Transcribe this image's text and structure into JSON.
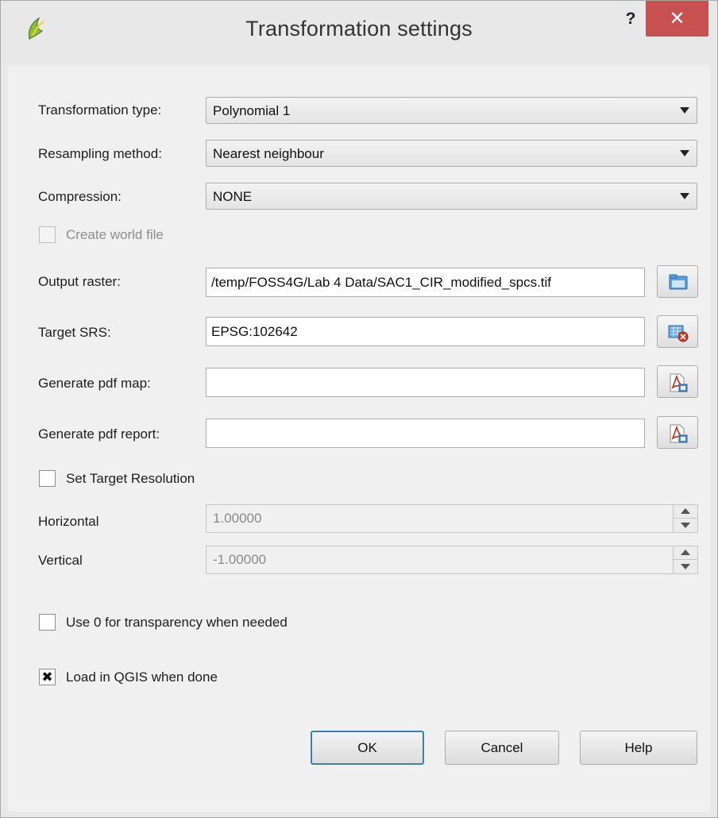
{
  "window": {
    "title": "Transformation settings",
    "help_glyph": "?",
    "close_glyph": "✕",
    "app_icon": "qgis-logo-icon"
  },
  "form": {
    "transformation_type": {
      "label": "Transformation type:",
      "value": "Polynomial 1"
    },
    "resampling_method": {
      "label": "Resampling method:",
      "value": "Nearest neighbour"
    },
    "compression": {
      "label": "Compression:",
      "value": "NONE"
    },
    "create_world_file": {
      "label": "Create world file",
      "checked": false,
      "enabled": false
    },
    "output_raster": {
      "label": "Output raster:",
      "value": "/temp/FOSS4G/Lab 4 Data/SAC1_CIR_modified_spcs.tif",
      "button_icon": "folder-open-icon"
    },
    "target_srs": {
      "label": "Target SRS:",
      "value": "EPSG:102642",
      "button_icon": "projection-select-icon"
    },
    "generate_pdf_map": {
      "label": "Generate pdf map:",
      "value": "",
      "button_icon": "pdf-file-icon"
    },
    "generate_pdf_report": {
      "label": "Generate pdf report:",
      "value": "",
      "button_icon": "pdf-file-icon"
    },
    "set_target_resolution": {
      "label": "Set Target Resolution",
      "checked": false
    },
    "horizontal": {
      "label": "Horizontal",
      "value": "1.00000"
    },
    "vertical": {
      "label": "Vertical",
      "value": "-1.00000"
    },
    "use_zero_transparency": {
      "label": "Use 0 for transparency when needed",
      "checked": false
    },
    "load_in_qgis": {
      "label": "Load in QGIS when done",
      "checked": true,
      "check_glyph": "✖"
    }
  },
  "buttons": {
    "ok": "OK",
    "cancel": "Cancel",
    "help": "Help"
  },
  "colors": {
    "close_button": "#c75050",
    "default_button_border": "#3c7fb1",
    "dialog_background": "#f0f0f0"
  }
}
